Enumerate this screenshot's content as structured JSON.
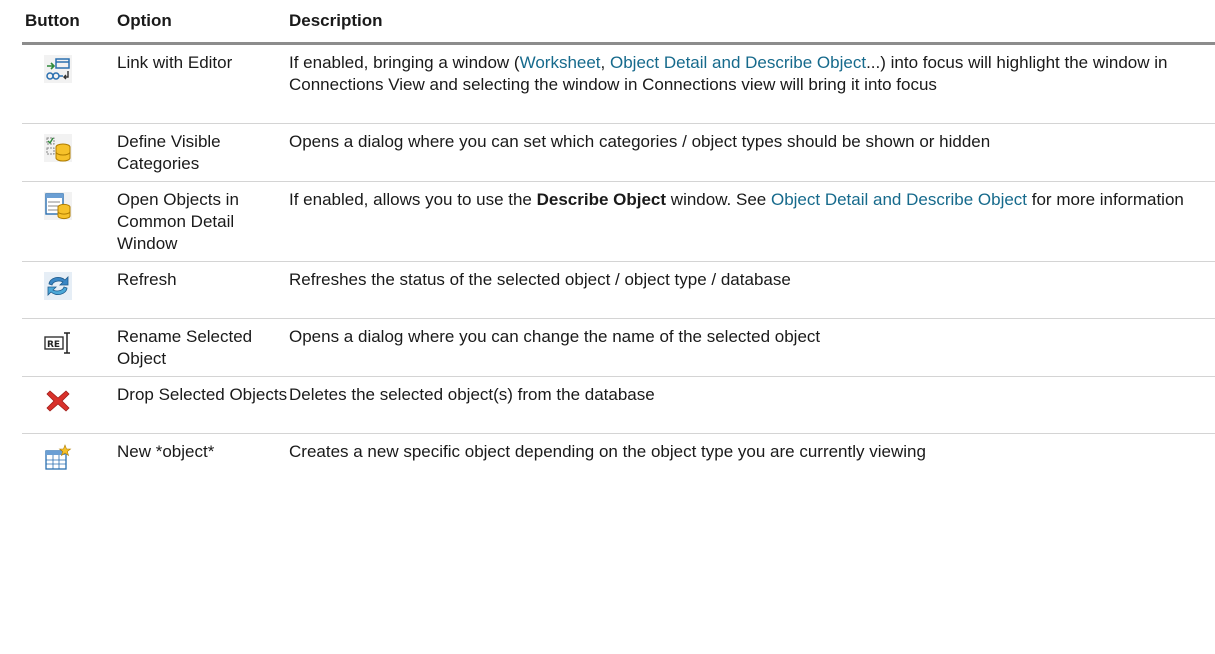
{
  "header": {
    "button": "Button",
    "option": "Option",
    "description": "Description"
  },
  "rows": [
    {
      "icon": "link-with-editor-icon",
      "option": "Link with Editor",
      "desc": {
        "pre": "If enabled, bringing a window (",
        "link1": "Worksheet",
        "sep": ", ",
        "link2": "Object Detail and Describe Object",
        "post": "...) into focus will highlight the window in Connections View and selecting the window in Connections view will bring it into focus"
      }
    },
    {
      "icon": "define-visible-categories-icon",
      "option": "Define Visible Categories",
      "desc": {
        "text": "Opens a dialog where you can set which categories / object types should be shown or hidden"
      }
    },
    {
      "icon": "open-objects-common-detail-icon",
      "option": "Open Objects in Common Detail Window",
      "desc": {
        "pre": "If enabled, allows you to use the ",
        "bold": "Describe Object",
        "mid": " window. See ",
        "link": "Object Detail and Describe Object",
        "post": " for more information"
      }
    },
    {
      "icon": "refresh-icon",
      "option": "Refresh",
      "desc": {
        "text": "Refreshes the status of the selected object / object type / database"
      }
    },
    {
      "icon": "rename-icon",
      "option": "Rename Selected Object",
      "desc": {
        "text": "Opens a dialog where you can change the name of the selected object"
      }
    },
    {
      "icon": "drop-icon",
      "option": "Drop Selected Objects",
      "desc": {
        "text": "Deletes the selected object(s) from the database"
      }
    },
    {
      "icon": "new-object-icon",
      "option": "New *object*",
      "desc": {
        "text": "Creates a new specific object depending on the object type you are currently viewing"
      }
    }
  ],
  "colors": {
    "link": "#166a8c",
    "header_rule": "#8c8c8c",
    "row_rule": "#d4d4d4"
  }
}
